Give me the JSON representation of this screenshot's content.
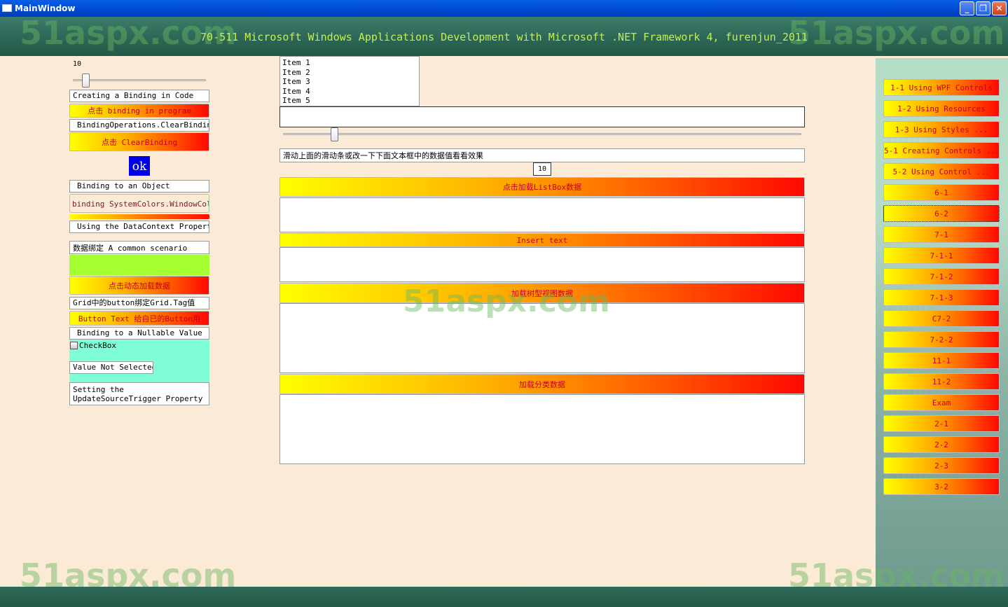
{
  "window": {
    "title": "MainWindow"
  },
  "header": {
    "title": "70-511 Microsoft Windows Applications Development with Microsoft .NET Framework 4, furenjun_2011"
  },
  "watermark": "51aspx.com",
  "left": {
    "slider_value": "10",
    "creating_binding_label": "Creating a Binding in Code",
    "binding_program_btn": "点击 binding in program",
    "clear_binding_label": "BindingOperations.ClearBinding",
    "clear_binding_btn": "点击 ClearBinding",
    "ok_btn": "ok",
    "binding_object_label": "Binding to an Object",
    "system_colors_label": "binding SystemColors.WindowColor",
    "datacontext_label": "Using the DataContext Property",
    "common_scenario_label": "数据绑定 A common scenario",
    "dynamic_load_btn": "点击动态加载数据",
    "grid_tag_label": "Grid中的button绑定Grid.Tag值",
    "button_text_btn": "Button Text 给自已的Button用",
    "nullable_label": "Binding to a Nullable Value",
    "checkbox_label": "CheckBox",
    "value_not_selected": "Value Not Selected",
    "update_source_label": "Setting the UpdateSourceTrigger Property"
  },
  "center": {
    "list_items": [
      "Item 1",
      "Item 2",
      "Item 3",
      "Item 4",
      "Item 5"
    ],
    "slider_hint": "滑动上面的滑动条或改一下下面文本框中的数据值看看效果",
    "value_box": "10",
    "load_listbox_btn": "点击加载ListBox数据",
    "insert_text_btn": "Insert text",
    "load_tree_btn": "加载树型视图数据",
    "load_category_btn": "加载分类数据"
  },
  "right": {
    "items": [
      "1-1 Using WPF Controls",
      "1-2 Using Resources",
      "1-3 Using Styles    ...",
      "5-1 Creating Controls ...",
      "5-2 Using Control    ...",
      "6-1",
      "6-2",
      "7-1",
      "7-1-1",
      "7-1-2",
      "7-1-3",
      "C7-2",
      "7-2-2",
      "11-1",
      "11-2",
      "Exam",
      "2-1",
      "2-2",
      "2-3",
      "3-2"
    ]
  },
  "colors": {
    "accent_yellow": "#ffff00",
    "accent_red": "#ff0800",
    "header_text": "#c4ef54",
    "ok_blue": "#0000e6",
    "checkbox_panel": "#7ffed8",
    "lime_panel": "#a5ff30"
  }
}
